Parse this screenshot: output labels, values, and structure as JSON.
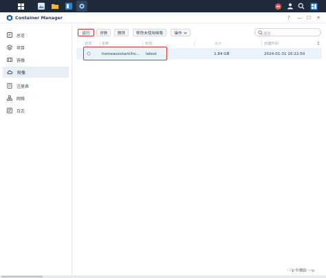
{
  "app": {
    "title": "Container Manager"
  },
  "window_controls": {
    "help": "?",
    "minimize": "—",
    "maximize": "☐",
    "close": "✕"
  },
  "sidebar": {
    "items": [
      {
        "label": "总览",
        "icon": "overview-icon",
        "active": false
      },
      {
        "label": "项目",
        "icon": "project-icon",
        "active": false
      },
      {
        "label": "容器",
        "icon": "container-icon",
        "active": false
      },
      {
        "label": "映像",
        "icon": "image-cloud-icon",
        "active": true
      },
      {
        "label": "注册表",
        "icon": "registry-icon",
        "active": false
      },
      {
        "label": "网络",
        "icon": "network-icon",
        "active": false
      },
      {
        "label": "日志",
        "icon": "log-icon",
        "active": false
      }
    ]
  },
  "toolbar": {
    "run": "运行",
    "details": "详情",
    "delete": "删除",
    "remove_unused": "移除未使用映像",
    "actions": "操作",
    "search_placeholder": "搜索"
  },
  "table": {
    "headers": {
      "status": "状态",
      "name": "名称",
      "tag": "标签",
      "size": "大小",
      "created": "创建时间"
    },
    "rows": [
      {
        "name": "homeassistant/ho...",
        "tag": "latest",
        "size": "1.84 GB",
        "created": "2024-01-31 16:22:50"
      }
    ]
  },
  "footer": {
    "count": "1 个项目",
    "refresh": "↻"
  },
  "watermark": "CSDN @zhiwenxxx",
  "colors": {
    "highlight_red": "#d92f2f",
    "row_selected": "#eaf2fc",
    "taskbar": "#1f2a3a"
  }
}
